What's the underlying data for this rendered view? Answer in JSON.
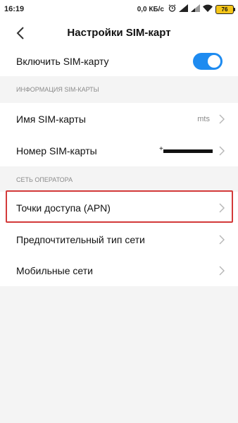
{
  "status_bar": {
    "time": "16:19",
    "speed": "0,0 КБ/с",
    "battery": "76"
  },
  "header": {
    "title": "Настройки SIM-карт"
  },
  "sim_toggle": {
    "label": "Включить SIM-карту",
    "enabled": true,
    "accent": "#1e8bf0"
  },
  "sections": {
    "sim_info": {
      "title": "ИНФОРМАЦИЯ SIM-КАРТЫ",
      "items": [
        {
          "label": "Имя SIM-карты",
          "value": "mts"
        },
        {
          "label": "Номер SIM-карты",
          "value": "+"
        }
      ]
    },
    "operator": {
      "title": "СЕТЬ ОПЕРАТОРА",
      "items": [
        {
          "label": "Точки доступа (APN)",
          "highlighted": true
        },
        {
          "label": "Предпочтительный тип сети"
        },
        {
          "label": "Мобильные сети"
        }
      ]
    }
  },
  "colors": {
    "highlight": "#d33a3a",
    "background": "#f4f4f4"
  }
}
